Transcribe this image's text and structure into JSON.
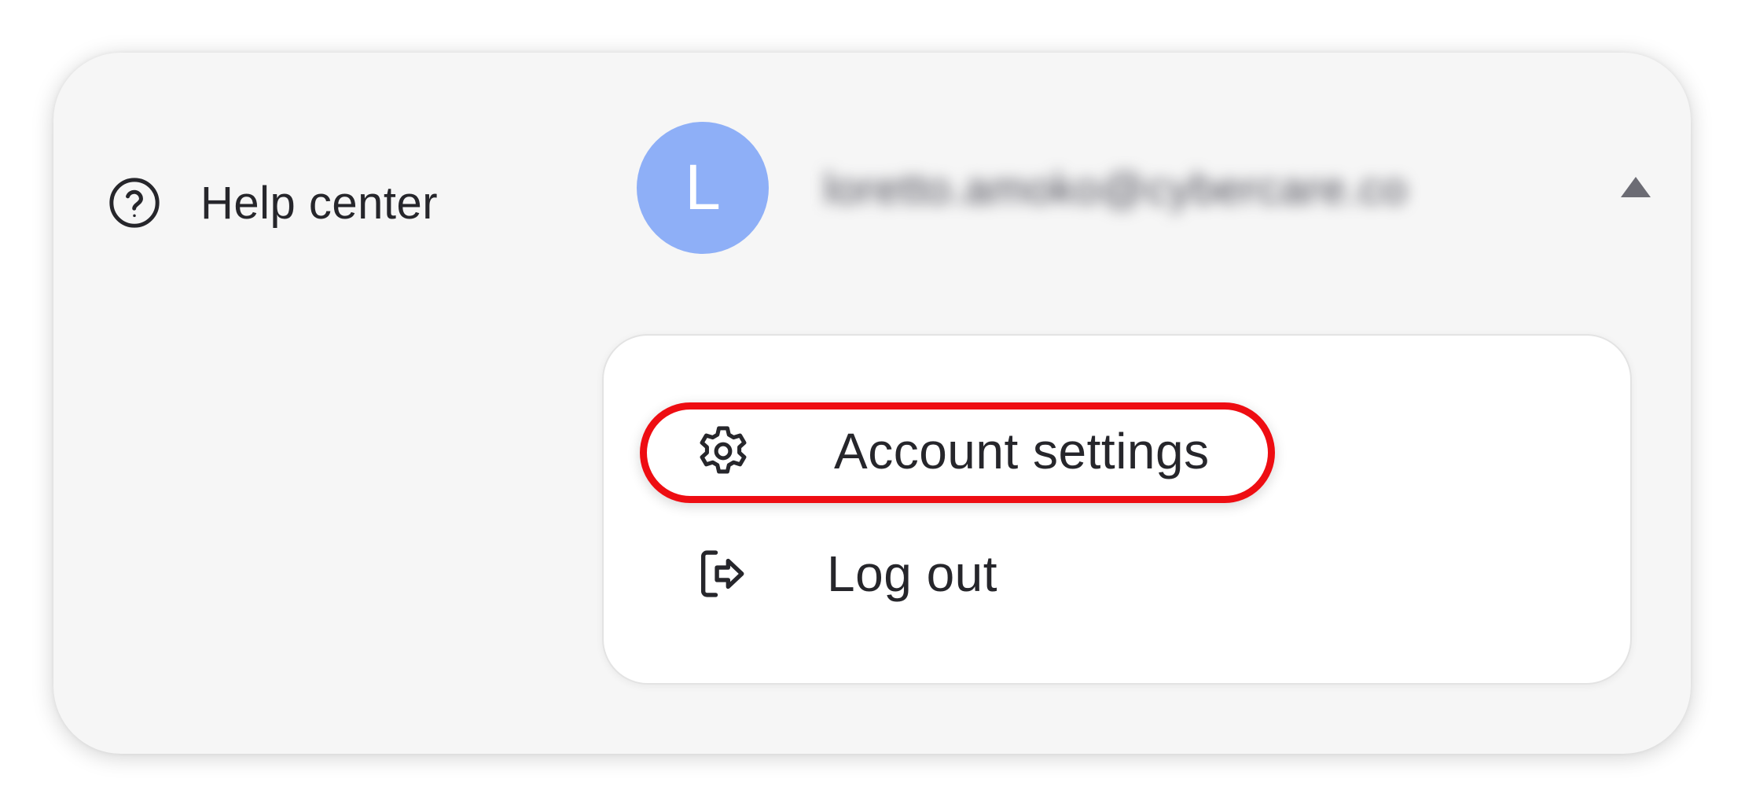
{
  "help_center": {
    "label": "Help center",
    "icon": "question-circle-icon"
  },
  "user": {
    "avatar_initial": "L",
    "avatar_color": "#8eaff7",
    "email": "loretto.amoko@cybercare.co",
    "email_redacted": true,
    "caret_icon": "caret-up-icon"
  },
  "menu": {
    "items": [
      {
        "label": "Account settings",
        "icon": "gear-icon",
        "highlighted": true
      },
      {
        "label": "Log out",
        "icon": "logout-icon",
        "highlighted": false
      }
    ]
  },
  "colors": {
    "card_background": "#f6f6f6",
    "menu_background": "#ffffff",
    "text": "#26262b",
    "highlight": "#ee0d12"
  }
}
